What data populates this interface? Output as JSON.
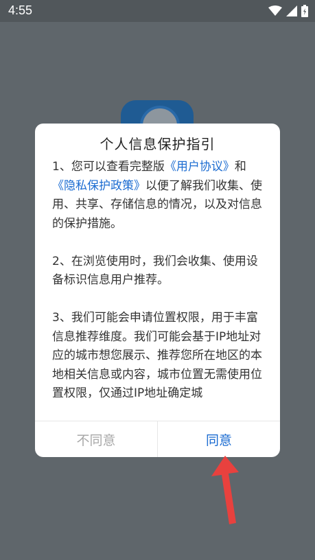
{
  "status_bar": {
    "time": "4:55"
  },
  "dialog": {
    "title": "个人信息保护指引",
    "para1": {
      "text_a": "1、您可以查看完整版",
      "link_user_agreement": "《用户协议》",
      "text_b": "和",
      "link_privacy_policy": "《隐私保护政策》",
      "text_c": "以便了解我们收集、使用、共享、存储信息的情况，以及对信息的保护措施。"
    },
    "para2": "2、在浏览使用时，我们会收集、使用设备标识信息用户推荐。",
    "para3": "3、我们可能会申请位置权限，用于丰富信息推荐维度。我们可能会基于IP地址对应的城市想您展示、推荐您所在地区的本地相关信息或内容，城市位置无需使用位置权限，仅通过IP地址确定城",
    "decline_label": "不同意",
    "agree_label": "同意"
  },
  "colors": {
    "link": "#1a6bd1",
    "arrow": "#e8413e",
    "scrim": "#5f666b"
  },
  "icons": [
    "wifi-icon",
    "signal-icon",
    "battery-icon",
    "red-arrow"
  ]
}
